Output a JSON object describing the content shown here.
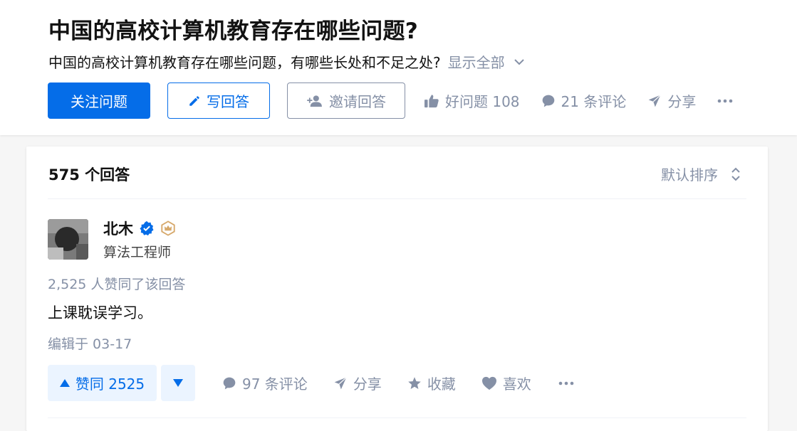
{
  "question": {
    "title": "中国的高校计算机教育存在哪些问题?",
    "detail": "中国的高校计算机教育存在哪些问题，有哪些长处和不足之处?",
    "show_all": "显示全部",
    "actions": {
      "follow": "关注问题",
      "write": "写回答",
      "invite": "邀请回答",
      "good_question": "好问题 108",
      "comments": "21 条评论",
      "share": "分享"
    }
  },
  "answers": {
    "count_label": "575 个回答",
    "sort_label": "默认排序"
  },
  "answer": {
    "author_name": "北木",
    "author_bio": "算法工程师",
    "voters_text": "2,525 人赞同了该回答",
    "content": "上课耽误学习。",
    "edited": "编辑于 03-17",
    "vote_up": "赞同 2525",
    "comments": "97 条评论",
    "share": "分享",
    "collect": "收藏",
    "like": "喜欢"
  },
  "colors": {
    "brand": "#056de8",
    "muted": "#8590a6",
    "vote_bg": "#ebf4ff"
  }
}
